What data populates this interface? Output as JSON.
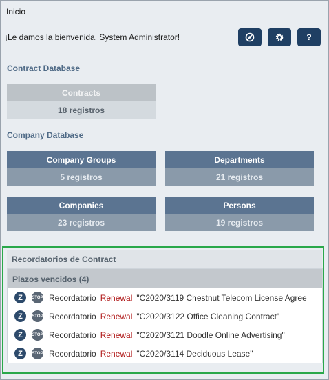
{
  "header": {
    "title": "Inicio",
    "welcome": "¡Le damos la bienvenida, System Administrator!",
    "buttons": [
      {
        "icon": "no-eye-icon",
        "glyph": "⌀"
      },
      {
        "icon": "gear-icon",
        "glyph": "⚙"
      },
      {
        "icon": "help-icon",
        "glyph": "?"
      }
    ]
  },
  "contract_db": {
    "title": "Contract Database",
    "cards": [
      {
        "name": "Contracts",
        "count": "18 registros"
      }
    ]
  },
  "company_db": {
    "title": "Company Database",
    "cards": [
      {
        "name": "Company Groups",
        "count": "5 registros"
      },
      {
        "name": "Departments",
        "count": "21 registros"
      },
      {
        "name": "Companies",
        "count": "23 registros"
      },
      {
        "name": "Persons",
        "count": "19 registros"
      }
    ]
  },
  "reminders": {
    "title": "Recordatorios de Contract",
    "subtitle": "Plazos vencidos (4)",
    "rows": [
      {
        "kind": "Recordatorio",
        "type": "Renewal",
        "desc": "\"C2020/3119 Chestnut Telecom License Agree"
      },
      {
        "kind": "Recordatorio",
        "type": "Renewal",
        "desc": "\"C2020/3122 Office Cleaning Contract\""
      },
      {
        "kind": "Recordatorio",
        "type": "Renewal",
        "desc": "\"C2020/3121 Doodle Online Advertising\""
      },
      {
        "kind": "Recordatorio",
        "type": "Renewal",
        "desc": "\"C2020/3114 Deciduous Lease\""
      }
    ],
    "icon_z": "Z",
    "icon_stop": "STOP"
  },
  "colors": {
    "accent": "#1f3f63",
    "card_header": "#5b7491",
    "highlight_border": "#2aa84a",
    "renewal": "#b01818"
  }
}
